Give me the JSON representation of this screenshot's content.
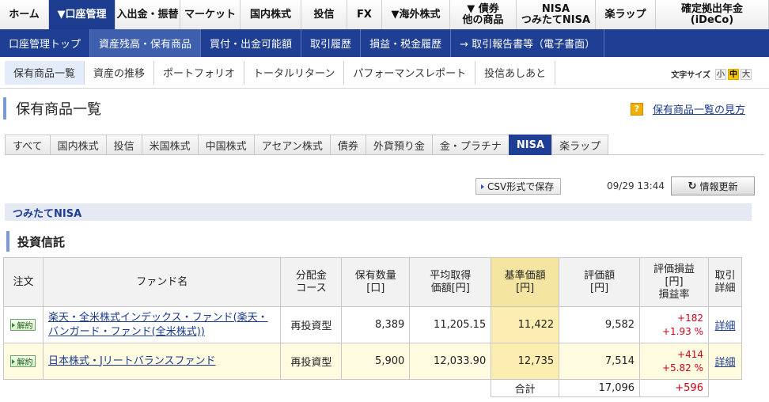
{
  "top_nav": [
    {
      "label": "ホーム"
    },
    {
      "label": "▼口座管理",
      "active": true
    },
    {
      "label": "入出金・振替"
    },
    {
      "label": "マーケット"
    },
    {
      "label": "国内株式"
    },
    {
      "label": "投信"
    },
    {
      "label": "FX"
    },
    {
      "label": "▼海外株式"
    },
    {
      "label": "▼ 債券\n他の商品"
    },
    {
      "label": "NISA\nつみたてNISA"
    },
    {
      "label": "楽ラップ"
    },
    {
      "label": "確定拠出年金\n(iDeCo)"
    }
  ],
  "sec_nav": [
    {
      "label": "口座管理トップ"
    },
    {
      "label": "資産残高・保有商品",
      "active": true
    },
    {
      "label": "買付・出金可能額"
    },
    {
      "label": "取引履歴"
    },
    {
      "label": "損益・税金履歴"
    },
    {
      "label": "→ 取引報告書等（電子書面）"
    }
  ],
  "ter_nav": [
    {
      "label": "保有商品一覧",
      "active": true
    },
    {
      "label": "資産の推移"
    },
    {
      "label": "ポートフォリオ"
    },
    {
      "label": "トータルリターン"
    },
    {
      "label": "パフォーマンスレポート"
    },
    {
      "label": "投信あしあと"
    }
  ],
  "font_size": {
    "label": "文字サイズ",
    "small": "小",
    "medium": "中",
    "large": "大"
  },
  "page_title": "保有商品一覧",
  "help_link": "保有商品一覧の見方",
  "help_icon_glyph": "?",
  "category_tabs": [
    {
      "label": "すべて"
    },
    {
      "label": "国内株式"
    },
    {
      "label": "投信"
    },
    {
      "label": "米国株式"
    },
    {
      "label": "中国株式"
    },
    {
      "label": "アセアン株式"
    },
    {
      "label": "債券"
    },
    {
      "label": "外貨預り金"
    },
    {
      "label": "金・プラチナ"
    },
    {
      "label": "NISA",
      "active": true
    },
    {
      "label": "楽ラップ"
    }
  ],
  "actions": {
    "csv_label": "CSV形式で保存",
    "timestamp": "09/29 13:44",
    "refresh_label": "情報更新"
  },
  "section_title": "つみたてNISA",
  "subsection_title": "投資信託",
  "table": {
    "headers": {
      "order": "注文",
      "fund": "ファンド名",
      "dist": "分配金\nコース",
      "qty": "保有数量\n[口]",
      "avg": "平均取得\n価額[円]",
      "nav": "基準価額\n[円]",
      "val": "評価額\n[円]",
      "pl": "評価損益\n[円]\n損益率",
      "detail": "取引\n詳細"
    },
    "rows": [
      {
        "order_badge": "解約",
        "fund": "楽天・全米株式インデックス・ファンド(楽天・バンガード・ファンド(全米株式))",
        "dist": "再投資型",
        "qty": "8,389",
        "avg": "11,205.15",
        "nav": "11,422",
        "val": "9,582",
        "pl": "+182",
        "pl_rate": "+1.93 %",
        "detail": "詳細"
      },
      {
        "order_badge": "解約",
        "fund": "日本株式・Jリートバランスファンド",
        "dist": "再投資型",
        "qty": "5,900",
        "avg": "12,033.90",
        "nav": "12,735",
        "val": "7,514",
        "pl": "+414",
        "pl_rate": "+5.82 %",
        "detail": "詳細"
      }
    ],
    "total": {
      "label": "合計",
      "val": "17,096",
      "pl": "+596"
    }
  },
  "colors": {
    "nav_blue": "#1e3f93",
    "highlight": "#fbeeb0",
    "positive": "#d0021b"
  }
}
